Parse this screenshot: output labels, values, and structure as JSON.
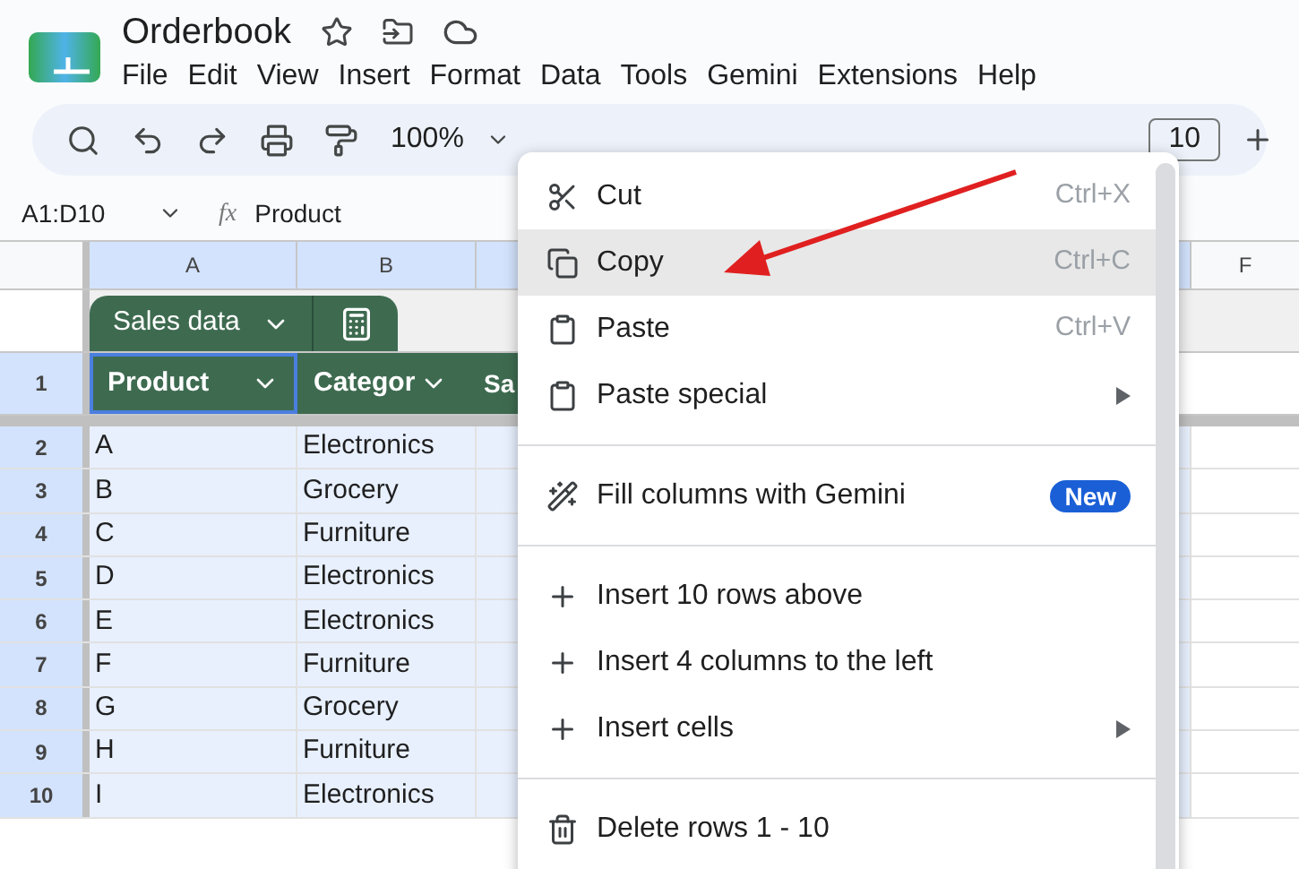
{
  "app": {
    "title": "Orderbook",
    "menu": [
      "File",
      "Edit",
      "View",
      "Insert",
      "Format",
      "Data",
      "Tools",
      "Gemini",
      "Extensions",
      "Help"
    ]
  },
  "toolbar": {
    "zoom": "100%",
    "font_size": "10"
  },
  "formula_bar": {
    "range": "A1:D10",
    "fx_label": "fx",
    "content": "Product"
  },
  "sheet": {
    "columns": [
      {
        "label": "A",
        "selected": true
      },
      {
        "label": "B",
        "selected": true
      },
      {
        "label": "F",
        "selected": false
      }
    ],
    "table": {
      "name": "Sales data",
      "header_row": "1",
      "headers": [
        "Product",
        "Categor",
        "Sa"
      ],
      "rows": [
        {
          "number": "2",
          "selected": true,
          "cells": [
            "A",
            "Electronics"
          ]
        },
        {
          "number": "3",
          "selected": true,
          "cells": [
            "B",
            "Grocery"
          ]
        },
        {
          "number": "4",
          "selected": true,
          "cells": [
            "C",
            "Furniture"
          ]
        },
        {
          "number": "5",
          "selected": true,
          "cells": [
            "D",
            "Electronics"
          ]
        },
        {
          "number": "6",
          "selected": true,
          "cells": [
            "E",
            "Electronics"
          ]
        },
        {
          "number": "7",
          "selected": true,
          "cells": [
            "F",
            "Furniture"
          ]
        },
        {
          "number": "8",
          "selected": true,
          "cells": [
            "G",
            "Grocery"
          ]
        },
        {
          "number": "9",
          "selected": true,
          "cells": [
            "H",
            "Furniture"
          ]
        },
        {
          "number": "10",
          "selected": true,
          "cells": [
            "I",
            "Electronics"
          ]
        }
      ]
    }
  },
  "context_menu": {
    "items": [
      {
        "kind": "item",
        "label": "Cut",
        "shortcut": "Ctrl+X",
        "selected": false
      },
      {
        "kind": "item",
        "label": "Copy",
        "shortcut": "Ctrl+C",
        "selected": true
      },
      {
        "kind": "item",
        "label": "Paste",
        "shortcut": "Ctrl+V",
        "selected": false
      },
      {
        "kind": "submenu",
        "label": "Paste special",
        "selected": false
      },
      {
        "kind": "divider"
      },
      {
        "kind": "item",
        "label": "Fill columns with Gemini",
        "badge": "New",
        "selected": false
      },
      {
        "kind": "divider"
      },
      {
        "kind": "item",
        "label": "Insert 10 rows above",
        "selected": false
      },
      {
        "kind": "item",
        "label": "Insert 4 columns to the left",
        "selected": false
      },
      {
        "kind": "submenu",
        "label": "Insert cells",
        "selected": false
      },
      {
        "kind": "divider"
      },
      {
        "kind": "item",
        "label": "Delete rows 1 - 10",
        "selected": false
      }
    ]
  }
}
